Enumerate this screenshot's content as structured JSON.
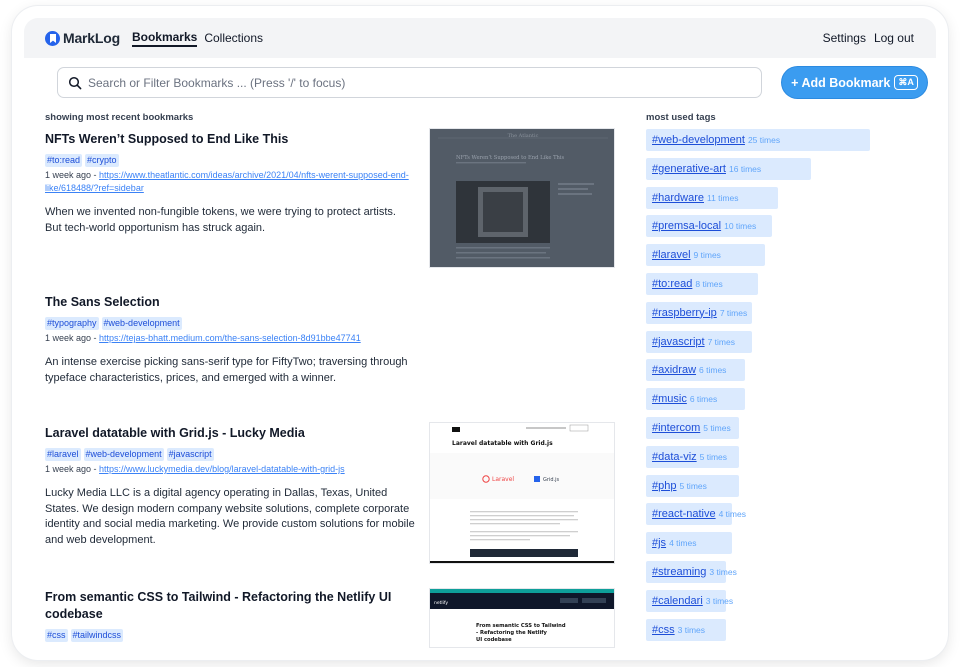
{
  "app": {
    "name": "MarkLog"
  },
  "nav": {
    "links": [
      {
        "label": "Bookmarks",
        "active": true
      },
      {
        "label": "Collections",
        "active": false
      }
    ],
    "right": [
      "Settings",
      "Log out"
    ]
  },
  "search": {
    "placeholder": "Search or Filter Bookmarks ...  (Press '/' to focus)"
  },
  "add_button": {
    "label": "+ Add Bookmark",
    "shortcut": "⌘A"
  },
  "bookmarks_section": {
    "heading": "showing most recent bookmarks"
  },
  "bookmarks": [
    {
      "title": "NFTs Weren’t Supposed to End Like This",
      "tags": [
        "#to:read",
        "#crypto"
      ],
      "age": "1 week ago",
      "url": "https://www.theatlantic.com/ideas/archive/2021/04/nfts-werent-supposed-end-like/618488/?ref=sidebar",
      "description": "When we invented non-fungible tokens, we were trying to protect artists. But tech-world opportunism has struck again."
    },
    {
      "title": "The Sans Selection",
      "tags": [
        "#typography",
        "#web-development"
      ],
      "age": "1 week ago",
      "url": "https://tejas-bhatt.medium.com/the-sans-selection-8d91bbe47741",
      "description": "An intense exercise picking sans-serif type for FiftyTwo; traversing through typeface characteristics, prices, and emerged with a winner."
    },
    {
      "title": "Laravel datatable with Grid.js - Lucky Media",
      "tags": [
        "#laravel",
        "#web-development",
        "#javascript"
      ],
      "age": "1 week ago",
      "url": "https://www.luckymedia.dev/blog/laravel-datatable-with-grid-js",
      "description": "Lucky Media LLC is a digital agency operating in Dallas, Texas, United States. We design modern company website solutions, complete corporate identity and social media marketing. We provide custom solutions for mobile and web development."
    },
    {
      "title": "From semantic CSS to Tailwind - Refactoring the Netlify UI codebase",
      "tags": [
        "#css",
        "#tailwindcss"
      ]
    }
  ],
  "thumbnails": {
    "atlantic": {
      "title_text": "NFTs Weren’t Supposed to End Like This",
      "masthead": "The Atlantic"
    },
    "lucky": {
      "heading": "Laravel datatable with Grid.js",
      "logo1": "Laravel",
      "logo2": "Grid.js"
    },
    "netlify": {
      "heading": "From semantic CSS to Tailwind - Refactoring the Netlify UI codebase",
      "brand": "netlify"
    }
  },
  "tags_section": {
    "heading": "most used tags"
  },
  "tags": [
    {
      "name": "#web-development",
      "count": "25 times",
      "weight": 1.0
    },
    {
      "name": "#generative-art",
      "count": "16 times",
      "weight": 0.64
    },
    {
      "name": "#hardware",
      "count": "11 times",
      "weight": 0.44
    },
    {
      "name": "#premsa-local",
      "count": "10 times",
      "weight": 0.4
    },
    {
      "name": "#laravel",
      "count": "9 times",
      "weight": 0.36
    },
    {
      "name": "#to:read",
      "count": "8 times",
      "weight": 0.32
    },
    {
      "name": "#raspberry-ip",
      "count": "7 times",
      "weight": 0.28
    },
    {
      "name": "#javascript",
      "count": "7 times",
      "weight": 0.28
    },
    {
      "name": "#axidraw",
      "count": "6 times",
      "weight": 0.24
    },
    {
      "name": "#music",
      "count": "6 times",
      "weight": 0.24
    },
    {
      "name": "#intercom",
      "count": "5 times",
      "weight": 0.2
    },
    {
      "name": "#data-viz",
      "count": "5 times",
      "weight": 0.2
    },
    {
      "name": "#php",
      "count": "5 times",
      "weight": 0.2
    },
    {
      "name": "#react-native",
      "count": "4 times",
      "weight": 0.16
    },
    {
      "name": "#js",
      "count": "4 times",
      "weight": 0.16
    },
    {
      "name": "#streaming",
      "count": "3 times",
      "weight": 0.12
    },
    {
      "name": "#calendari",
      "count": "3 times",
      "weight": 0.12
    },
    {
      "name": "#css",
      "count": "3 times",
      "weight": 0.12
    }
  ],
  "colors": {
    "accent": "#3b9cf0",
    "tag_bg": "#dbeafe",
    "tag_text": "#1d4ed8",
    "link": "#3b82f6"
  }
}
